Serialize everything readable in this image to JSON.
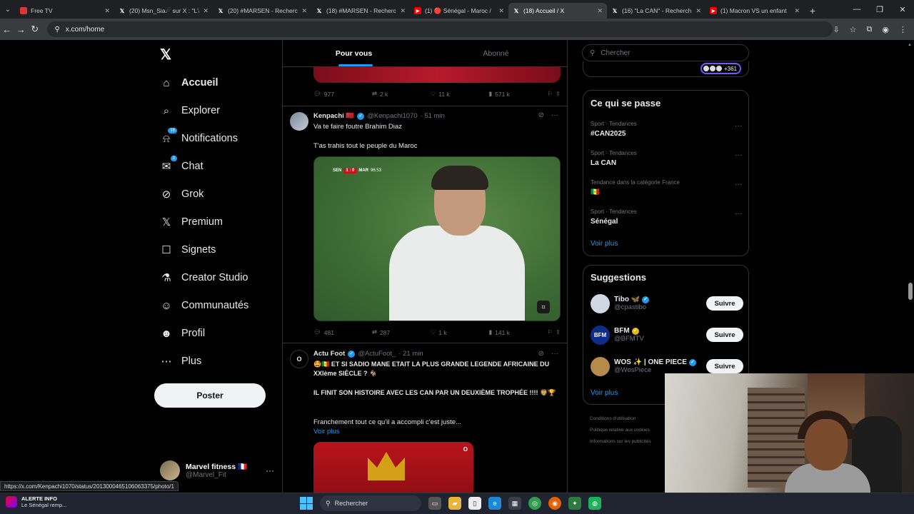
{
  "browser": {
    "tabs": [
      {
        "title": "Free TV",
        "icon": "tv-icon"
      },
      {
        "title": "(20) Msn_Sia☄ sur X : \"L'a",
        "icon": "x-icon"
      },
      {
        "title": "(20) #MARSEN - Recherch",
        "icon": "x-icon"
      },
      {
        "title": "(18) #MARSEN - Recherch",
        "icon": "x-icon"
      },
      {
        "title": "(1) 🔴 Sénégal - Maroc /",
        "icon": "youtube-icon"
      },
      {
        "title": "(18) Accueil / X",
        "icon": "x-icon",
        "active": true
      },
      {
        "title": "(16) \"La CAN\" - Recherch",
        "icon": "x-icon"
      },
      {
        "title": "(1) Macron VS un enfant",
        "icon": "youtube-icon"
      }
    ],
    "url": "x.com/home",
    "status_url": "https://x.com/Kenpachi1070/status/2013000465106063375/photo/1"
  },
  "nav": {
    "items": [
      {
        "label": "Accueil",
        "icon": "home-icon",
        "glyph": "⌂"
      },
      {
        "label": "Explorer",
        "icon": "search-icon",
        "glyph": "⌕"
      },
      {
        "label": "Notifications",
        "icon": "bell-icon",
        "glyph": "⍾",
        "badge": "16"
      },
      {
        "label": "Chat",
        "icon": "mail-icon",
        "glyph": "✉",
        "badge": "2"
      },
      {
        "label": "Grok",
        "icon": "grok-icon",
        "glyph": "⊘"
      },
      {
        "label": "Premium",
        "icon": "x-logo-icon",
        "glyph": "𝕏"
      },
      {
        "label": "Signets",
        "icon": "bookmark-icon",
        "glyph": "☐"
      },
      {
        "label": "Creator Studio",
        "icon": "flask-icon",
        "glyph": "⚗"
      },
      {
        "label": "Communautés",
        "icon": "people-icon",
        "glyph": "☺"
      },
      {
        "label": "Profil",
        "icon": "person-icon",
        "glyph": "☻"
      },
      {
        "label": "Plus",
        "icon": "more-circle-icon",
        "glyph": "⋯"
      }
    ],
    "post_label": "Poster",
    "account": {
      "name": "Marvel fitness 🇫🇷",
      "handle": "@Marvel_Fit"
    }
  },
  "feed": {
    "tabs": [
      "Pour vous",
      "Abonné"
    ],
    "promo_actions": {
      "replies": "977",
      "reposts": "2 k",
      "likes": "11 k",
      "views": "571 k"
    },
    "tweets": [
      {
        "name": "Kenpachi 🇲🇦",
        "handle": "@Kenpachi1070",
        "time": "· 51 min",
        "text1": "Va te faire foutre Brahim Diaz",
        "text2": "T'as trahis tout le peuple du Maroc",
        "scorebug": {
          "home": "SEN",
          "score": "1 : 0",
          "away": "MAR",
          "clock": "96:53"
        },
        "actions": {
          "replies": "481",
          "reposts": "287",
          "likes": "1 k",
          "views": "141 k"
        }
      },
      {
        "name": "Actu Foot",
        "handle": "@ActuFoot_",
        "time": "· 21 min",
        "text1": "🤩🇸🇳 ET SI SADIO MANE ETAIT LA PLUS GRANDE LEGENDE AFRICAINE DU XXIème SIÈCLE ? 🐐",
        "text2": "IL FINIT SON HISTOIRE AVEC LES CAN PAR UN DEUXIÈME TROPHÉE !!!! 🦁🏆",
        "text3": "Franchement tout ce qu'il a accompli c'est juste...",
        "more": "Voir plus"
      }
    ],
    "media_logo": "O"
  },
  "right": {
    "search_placeholder": "Chercher",
    "pill_count": "+361",
    "trends_title": "Ce qui se passe",
    "trends": [
      {
        "category": "Sport · Tendances",
        "title": "#CAN2025"
      },
      {
        "category": "Sport · Tendances",
        "title": "La CAN"
      },
      {
        "category": "Tendance dans la catégorie France",
        "title": "🇸🇳"
      },
      {
        "category": "Sport · Tendances",
        "title": "Sénégal"
      }
    ],
    "trends_more": "Voir plus",
    "suggestions_title": "Suggestions",
    "suggestions": [
      {
        "name": "Tibo 🦋",
        "handle": "@cpastibo",
        "avatar": "",
        "avatar_color": "#cfd8e3",
        "badge": "blue"
      },
      {
        "name": "BFM",
        "handle": "@BFMTV",
        "avatar": "BFM",
        "avatar_color": "#0c2d8a",
        "badge": "gold"
      },
      {
        "name": "WOS ✨ | ONE PIECE",
        "handle": "@WosPiece",
        "avatar": "",
        "avatar_color": "#b58a4a",
        "badge": "blue"
      }
    ],
    "follow_label": "Suivre",
    "suggestions_more": "Voir plus",
    "footer": [
      "Conditions d'utilisation",
      "Politique relative aux cookies",
      "Informations sur les publicités"
    ]
  },
  "taskbar": {
    "alert_title": "ALERTE INFO",
    "alert_text": "Le Sénégal remp...",
    "search_placeholder": "Rechercher"
  }
}
